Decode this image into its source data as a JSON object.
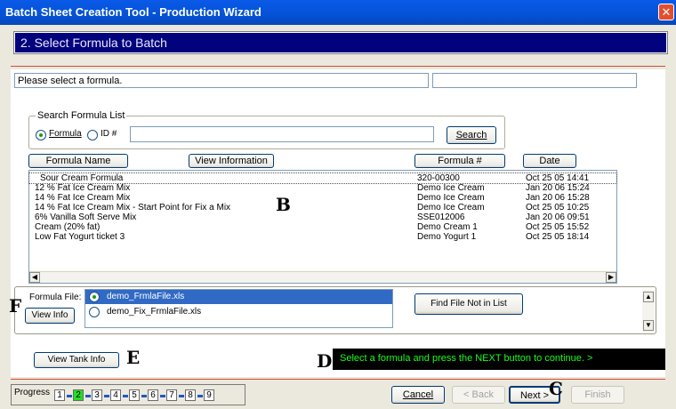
{
  "window": {
    "title": "Batch Sheet Creation Tool - Production Wizard",
    "close_glyph": "✕"
  },
  "step": {
    "title": "2. Select Formula to Batch"
  },
  "prompt": {
    "message": "Please select a formula.",
    "secondary": ""
  },
  "search": {
    "group_label": "Search Formula List",
    "radio_formula": "Formula",
    "radio_id": "ID #",
    "selected": "Formula",
    "query": "",
    "button": "Search"
  },
  "formula_list": {
    "headers": {
      "name": "Formula Name",
      "info": "View Information",
      "number": "Formula #",
      "date": "Date"
    },
    "rows": [
      {
        "name": "Sour Cream Formula",
        "number": "320-00300",
        "date": "Oct 25 05  14:41"
      },
      {
        "name": "12 % Fat Ice Cream Mix",
        "number": "Demo Ice Cream",
        "date": "Jan 20 06  15:24"
      },
      {
        "name": "14 % Fat Ice Cream Mix",
        "number": "Demo Ice Cream",
        "date": "Jan 20 06  15:28"
      },
      {
        "name": "14 % Fat Ice Cream Mix - Start Point for Fix a Mix",
        "number": "Demo Ice Cream",
        "date": "Oct 25 05  10:25"
      },
      {
        "name": "6% Vanilla Soft Serve Mix",
        "number": "SSE012006",
        "date": "Jan 20 06  09:51"
      },
      {
        "name": "Cream (20% fat)",
        "number": "Demo Cream 1",
        "date": "Oct 25 05  15:52"
      },
      {
        "name": "Low Fat Yogurt ticket 3",
        "number": "Demo Yogurt 1",
        "date": "Oct 25 05  18:14"
      }
    ]
  },
  "formula_file": {
    "label": "Formula File:",
    "view_info": "View Info",
    "files": [
      "demo_FrmlaFile.xls",
      "demo_Fix_FrmlaFile.xls"
    ],
    "selected_index": 0,
    "find_button": "Find File Not in List"
  },
  "tank": {
    "button": "View Tank Info"
  },
  "status": {
    "message": "Select a formula and press the NEXT button to continue. >"
  },
  "markers": {
    "b": "B",
    "c": "C",
    "d": "D",
    "e": "E",
    "f": "F"
  },
  "progress": {
    "label": "Progress",
    "steps": [
      "1",
      "2",
      "3",
      "4",
      "5",
      "6",
      "7",
      "8",
      "9"
    ],
    "current": 2
  },
  "nav": {
    "cancel": "Cancel",
    "back": "< Back",
    "next": "Next >",
    "finish": "Finish"
  },
  "colors": {
    "title_bar": "#0452d6",
    "step_bar": "#02027c",
    "status_text": "#19ff19",
    "progress_current": "#22e022",
    "divider": "#d64a3a"
  }
}
